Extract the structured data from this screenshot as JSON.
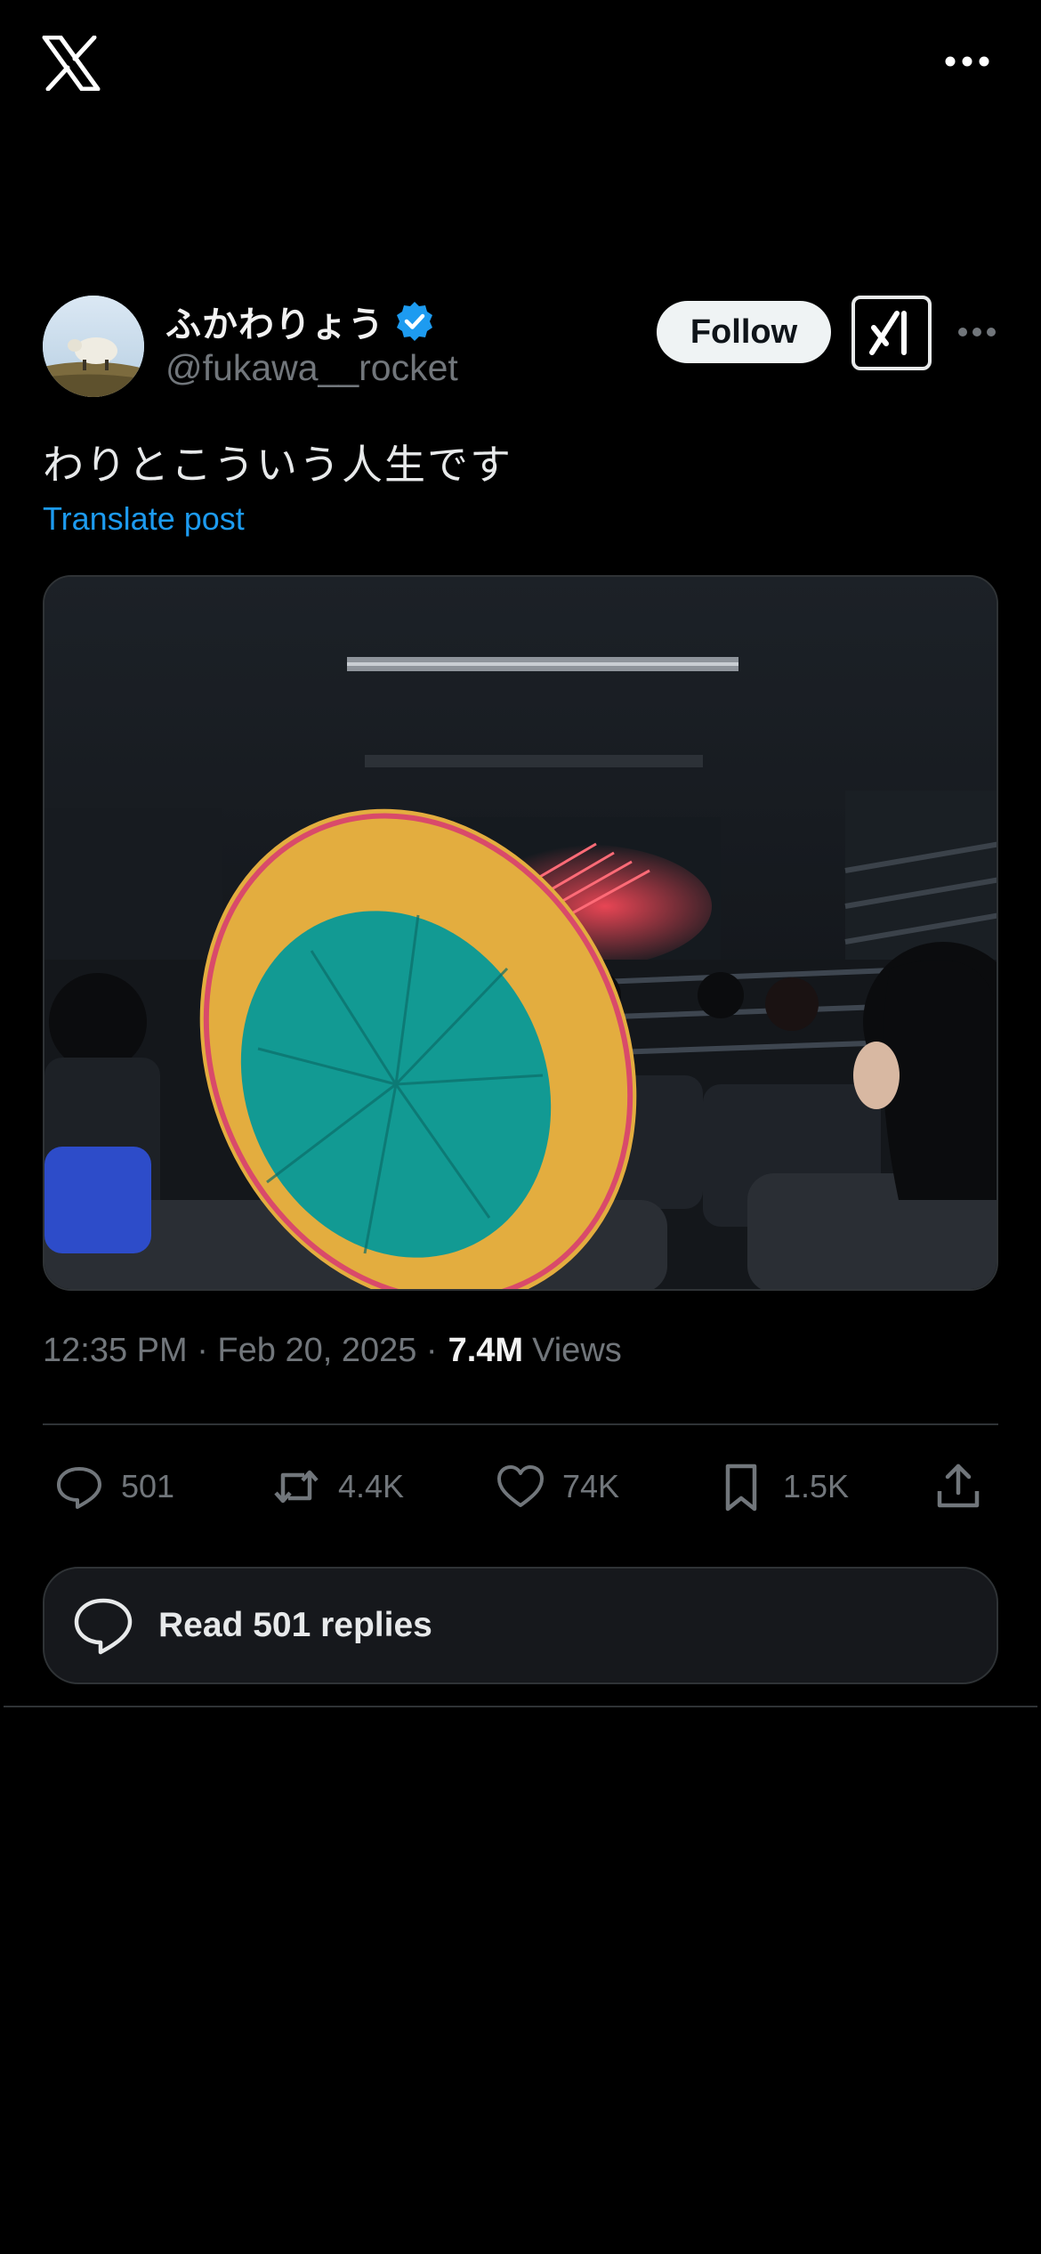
{
  "app": {
    "logo_icon": "x-logo-icon",
    "more_icon": "more-horizontal-icon"
  },
  "author": {
    "display_name": "ふかわりょう",
    "handle": "@fukawa__rocket",
    "verified_icon": "verified-badge-icon",
    "follow_label": "Follow",
    "grok_icon": "grok-icon"
  },
  "post": {
    "text": "わりとこういう人生です",
    "translate_label": "Translate post",
    "time": "12:35 PM · Feb 20, 2025 · ",
    "views_count": "7.4M",
    "views_label": "Views"
  },
  "actions": {
    "replies": "501",
    "reposts": "4.4K",
    "likes": "74K",
    "bookmarks": "1.5K"
  },
  "read_replies_label": "Read 501 replies",
  "colors": {
    "background": "#000000",
    "link": "#1d9bf0",
    "muted": "#71767b",
    "verified": "#1d9bf0"
  }
}
